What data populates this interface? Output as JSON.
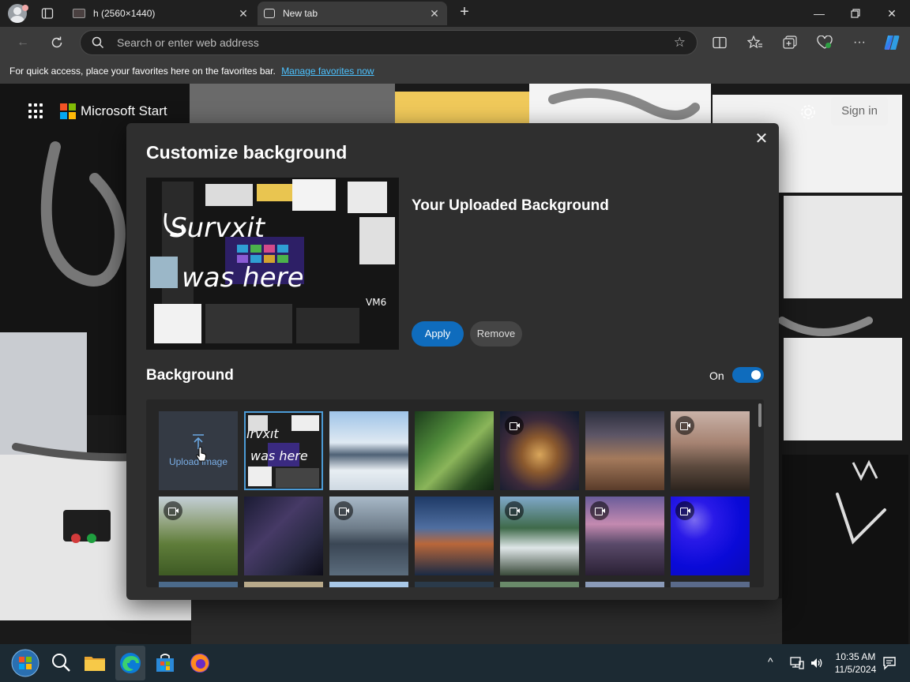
{
  "browser": {
    "tabs": [
      {
        "title": "h (2560×1440)",
        "active": false
      },
      {
        "title": "New tab",
        "active": true
      }
    ],
    "address_placeholder": "Search or enter web address",
    "favorites_bar": {
      "message": "For quick access, place your favorites here on the favorites bar.",
      "link": "Manage favorites now"
    }
  },
  "start_page": {
    "brand": "Microsoft Start",
    "sign_in": "Sign in"
  },
  "dialog": {
    "title": "Customize background",
    "uploaded_title": "Your Uploaded Background",
    "apply_label": "Apply",
    "remove_label": "Remove",
    "background_section_title": "Background",
    "toggle_label": "On",
    "toggle_on": true,
    "upload_label": "Upload image",
    "thumbnails": [
      {
        "kind": "upload"
      },
      {
        "kind": "image",
        "subject": "uploaded-scribble",
        "selected": true
      },
      {
        "kind": "image",
        "subject": "snowy-mountains"
      },
      {
        "kind": "image",
        "subject": "forest-path"
      },
      {
        "kind": "video",
        "subject": "coral-reef"
      },
      {
        "kind": "image",
        "subject": "desert-dunes"
      },
      {
        "kind": "video",
        "subject": "misty-cliffs"
      },
      {
        "kind": "video",
        "subject": "green-mountains"
      },
      {
        "kind": "image",
        "subject": "milky-way"
      },
      {
        "kind": "video",
        "subject": "city-skyline-water"
      },
      {
        "kind": "image",
        "subject": "island-city-night"
      },
      {
        "kind": "video",
        "subject": "waterfall-mountains"
      },
      {
        "kind": "video",
        "subject": "city-sunset"
      },
      {
        "kind": "video",
        "subject": "blue-jellyfish"
      }
    ]
  },
  "taskbar": {
    "clock_time": "10:35 AM",
    "clock_date": "11/5/2024"
  },
  "colors": {
    "accent": "#0f6cbd",
    "dialog_bg": "#2f2f2f",
    "link": "#4cc2ff"
  }
}
